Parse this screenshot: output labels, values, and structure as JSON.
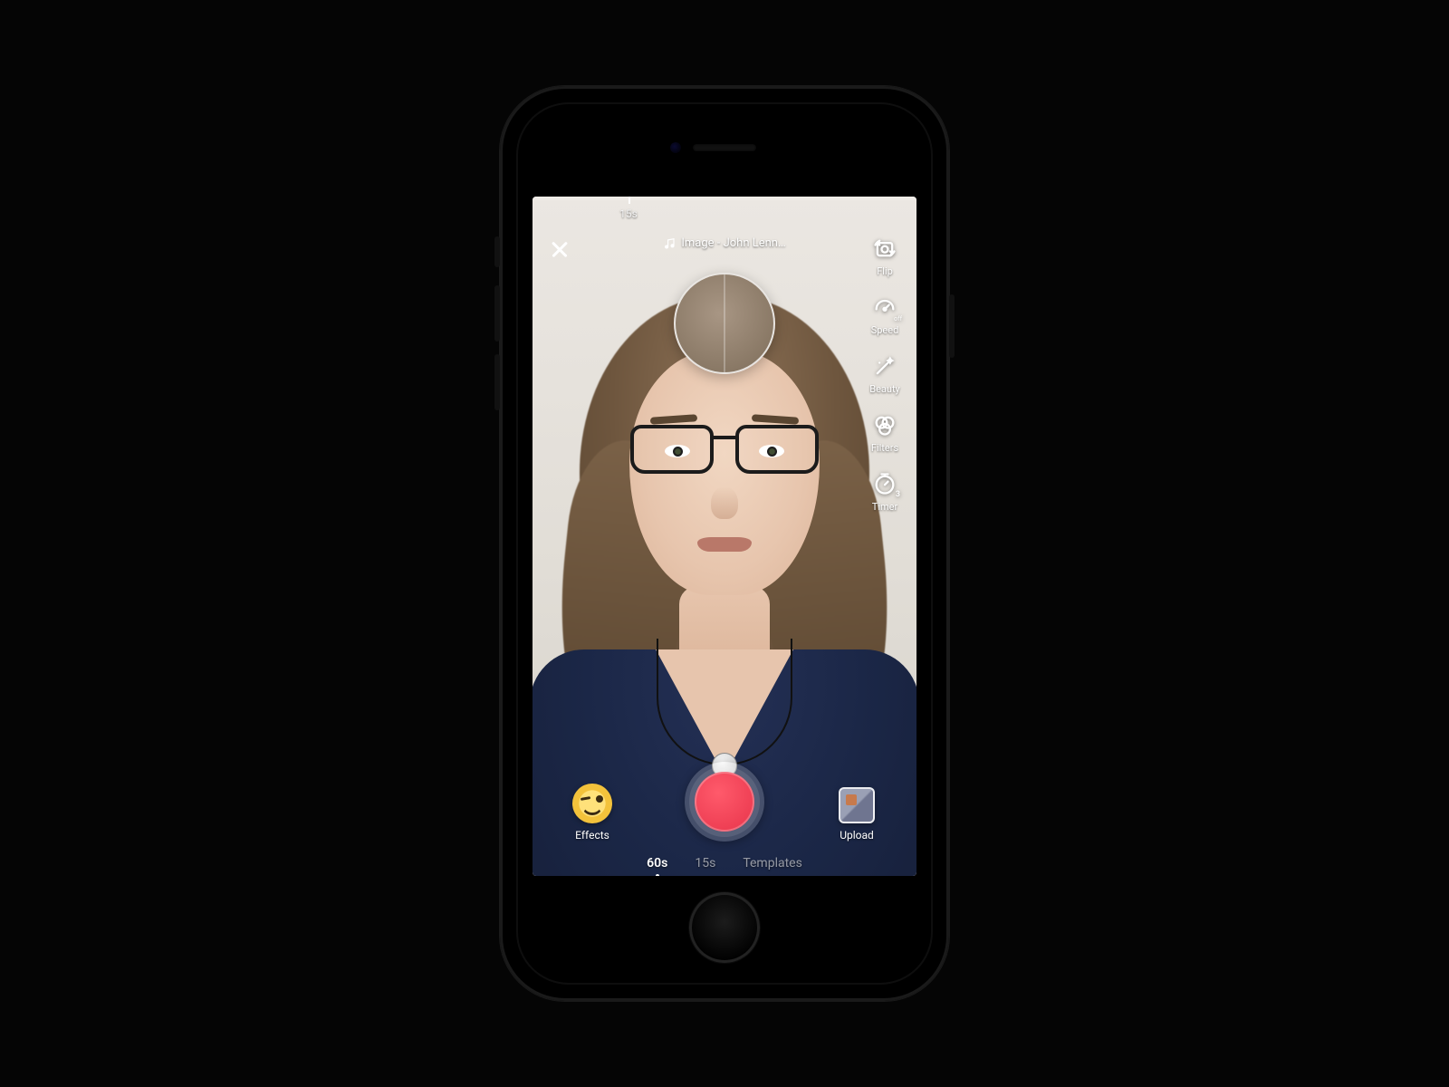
{
  "timeline": {
    "tick_label": "15s",
    "tick_position_pct": 25
  },
  "header": {
    "sound_label": "Image - John Lenn…"
  },
  "tools": {
    "flip": {
      "label": "Flip",
      "name": "flip-icon"
    },
    "speed": {
      "label": "Speed",
      "name": "speed-icon",
      "badge": "off"
    },
    "beauty": {
      "label": "Beauty",
      "name": "beauty-icon"
    },
    "filters": {
      "label": "Filters",
      "name": "filters-icon"
    },
    "timer": {
      "label": "Timer",
      "name": "timer-icon",
      "badge": "3"
    }
  },
  "bottom": {
    "effects_label": "Effects",
    "upload_label": "Upload"
  },
  "modes": {
    "items": [
      "60s",
      "15s",
      "Templates"
    ],
    "active_index": 0
  },
  "colors": {
    "record": "#e7334a",
    "accent_text": "#ffffff"
  }
}
